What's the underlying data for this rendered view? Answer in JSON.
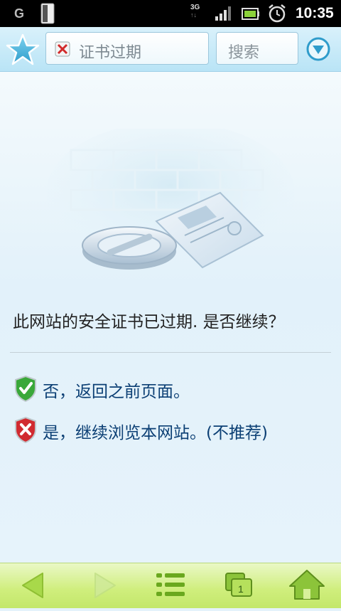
{
  "status_bar": {
    "carrier_icon_letter": "G",
    "network_type": "3G",
    "time": "10:35",
    "icons": [
      "sim-card-icon",
      "signal-icon",
      "battery-icon",
      "alarm-icon"
    ]
  },
  "toolbar": {
    "url_text": "证书过期",
    "search_placeholder": "搜索",
    "icons": [
      "favorites-star-icon",
      "certificate-error-icon",
      "dropdown-menu-icon"
    ]
  },
  "content": {
    "question": "此网站的安全证书已过期. 是否继续？",
    "options": [
      {
        "label": "否，返回之前页面。",
        "icon": "green-check-shield-icon",
        "color": "#2e9b2e"
      },
      {
        "label": "是，继续浏览本网站。(不推荐)",
        "icon": "red-x-shield-icon",
        "color": "#c8262d"
      }
    ]
  },
  "bottom_bar": {
    "tab_count": "1",
    "buttons": [
      "back-icon",
      "forward-icon",
      "menu-list-icon",
      "tabs-icon",
      "home-icon"
    ]
  },
  "colors": {
    "toolbar_bg": "#c7eaf8",
    "content_bg": "#e4f2fb",
    "bottom_bar_bg": "#d3ef86",
    "option_text": "#0b3f74"
  }
}
